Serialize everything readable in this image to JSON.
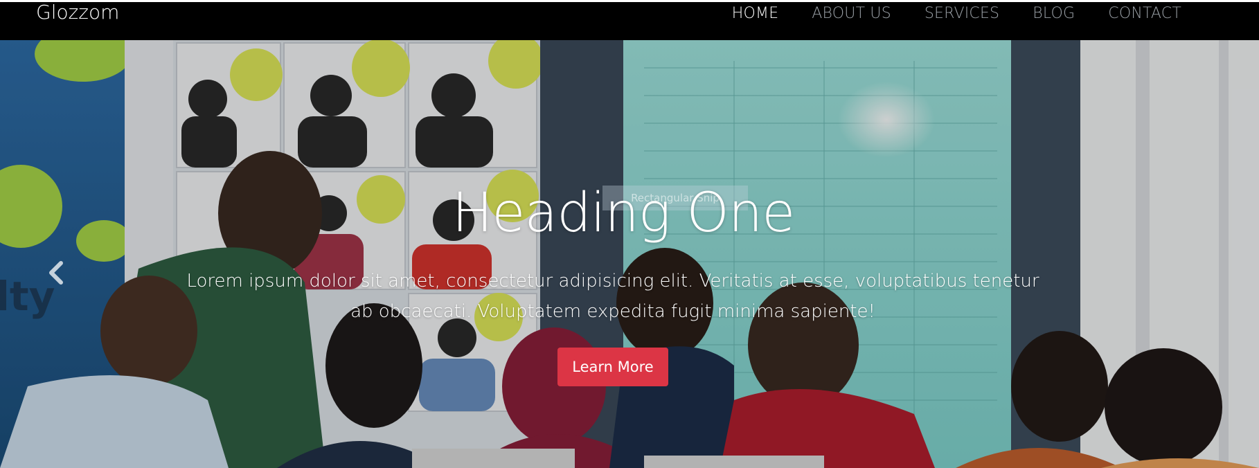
{
  "navbar": {
    "brand": "Glozzom",
    "items": [
      {
        "label": "HOME",
        "active": true
      },
      {
        "label": "ABOUT US",
        "active": false
      },
      {
        "label": "SERVICES",
        "active": false
      },
      {
        "label": "BLOG",
        "active": false
      },
      {
        "label": "CONTACT",
        "active": false
      }
    ]
  },
  "hero": {
    "heading": "Heading One",
    "overlay_label": "Rectangular Snip",
    "lead": "Lorem ipsum dolor sit amet, consectetur adipisicing elit. Veritatis at esse, voluptatibus tenetur ab obcaecati. Voluptatem expedita fugit minima sapiente!",
    "cta_label": "Learn More",
    "prev_icon": "chevron-left-icon",
    "next_icon": "chevron-right-icon",
    "background_image": "group of students with laptops in front of a results board"
  },
  "colors": {
    "navbar_bg": "#000000",
    "nav_active": "#ffffff",
    "nav_inactive": "#9aa0a6",
    "cta_bg": "#dc3545",
    "hero_text": "#ffffff"
  }
}
